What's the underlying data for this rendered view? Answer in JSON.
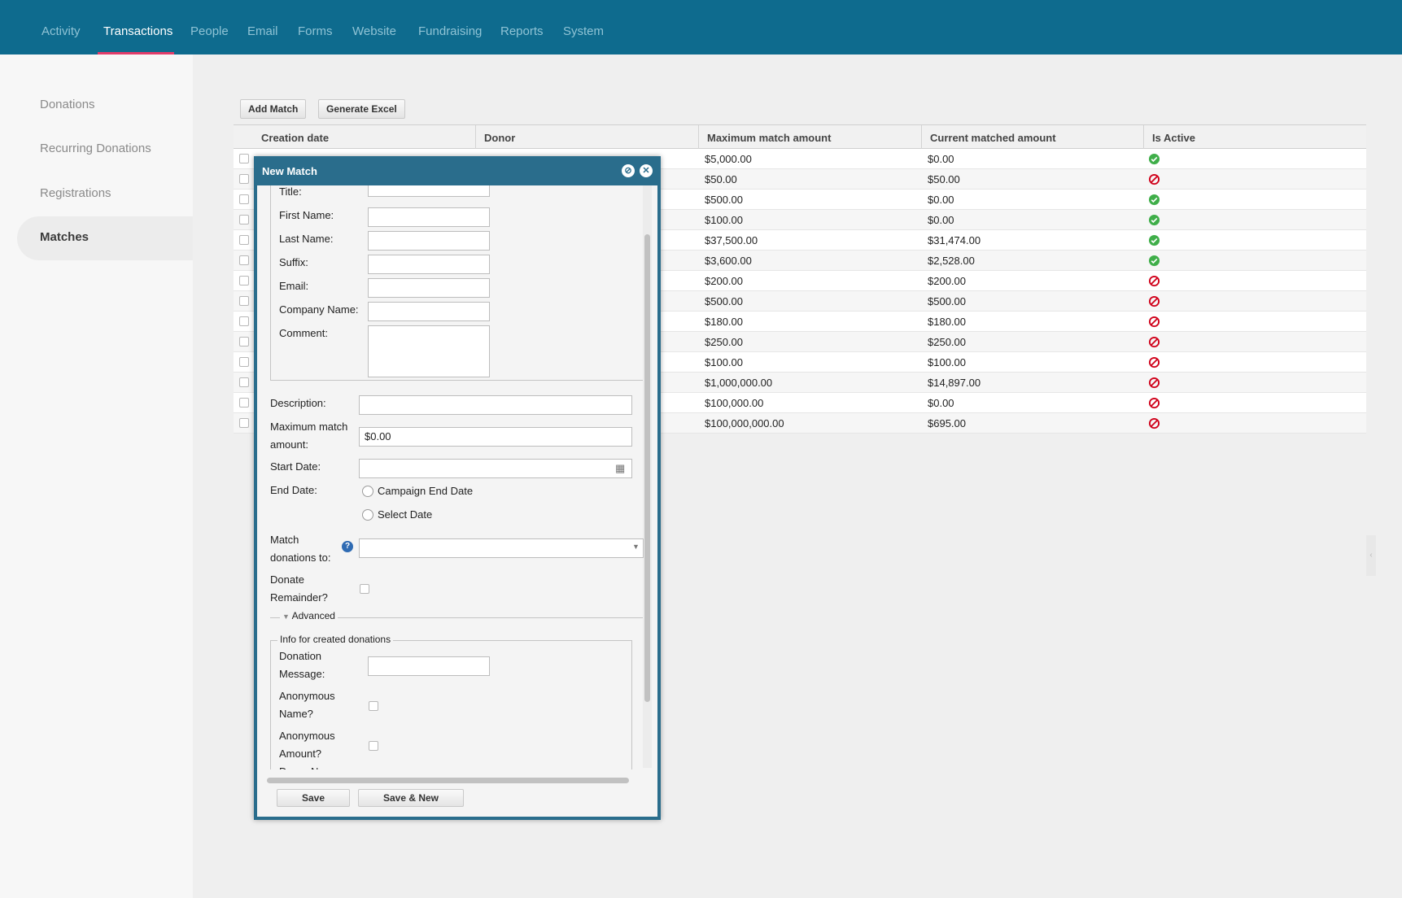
{
  "nav": {
    "tabs": [
      "Activity",
      "Transactions",
      "People",
      "Email",
      "Forms",
      "Website",
      "Fundraising",
      "Reports",
      "System"
    ],
    "active_tab": "Transactions"
  },
  "sidebar": {
    "items": [
      "Donations",
      "Recurring Donations",
      "Registrations",
      "Matches"
    ],
    "active": "Matches"
  },
  "toolbar": {
    "add_label": "Add Match",
    "excel_label": "Generate Excel"
  },
  "grid": {
    "columns": [
      "Creation date",
      "Donor",
      "Maximum match amount",
      "Current matched amount",
      "Is Active"
    ],
    "rows": [
      {
        "max": "$5,000.00",
        "current": "$0.00",
        "active": true
      },
      {
        "max": "$50.00",
        "current": "$50.00",
        "active": false
      },
      {
        "max": "$500.00",
        "current": "$0.00",
        "active": true
      },
      {
        "max": "$100.00",
        "current": "$0.00",
        "active": true
      },
      {
        "max": "$37,500.00",
        "current": "$31,474.00",
        "active": true
      },
      {
        "max": "$3,600.00",
        "current": "$2,528.00",
        "active": true
      },
      {
        "max": "$200.00",
        "current": "$200.00",
        "active": false
      },
      {
        "max": "$500.00",
        "current": "$500.00",
        "active": false
      },
      {
        "max": "$180.00",
        "current": "$180.00",
        "active": false
      },
      {
        "max": "$250.00",
        "current": "$250.00",
        "active": false
      },
      {
        "max": "$100.00",
        "current": "$100.00",
        "active": false
      },
      {
        "max": "$1,000,000.00",
        "current": "$14,897.00",
        "active": false
      },
      {
        "max": "$100,000.00",
        "current": "$0.00",
        "active": false
      },
      {
        "max": "$100,000,000.00",
        "current": "$695.00",
        "active": false
      }
    ],
    "active_color": "#3fae49",
    "inactive_color": "#d0021b"
  },
  "modal": {
    "title": "New Match",
    "fields": {
      "title": "Title:",
      "first_name": "First Name:",
      "last_name": "Last Name:",
      "suffix": "Suffix:",
      "email": "Email:",
      "company": "Company Name:",
      "comment": "Comment:",
      "description": "Description:",
      "max_match_1": "Maximum match",
      "max_match_2": "amount:",
      "max_match_value": "$0.00",
      "start_date": "Start Date:",
      "end_date": "End Date:",
      "end_opt1": "Campaign End Date",
      "end_opt2": "Select Date",
      "match_to_1": "Match",
      "match_to_2": "donations to:",
      "donate_rem_1": "Donate",
      "donate_rem_2": "Remainder?",
      "advanced": "Advanced",
      "info_legend": "Info for created donations",
      "don_msg_1": "Donation",
      "don_msg_2": "Message:",
      "anon_name_1": "Anonymous",
      "anon_name_2": "Name?",
      "anon_amt_1": "Anonymous",
      "anon_amt_2": "Amount?",
      "donor_name": "Donor Name"
    },
    "save_label": "Save",
    "save_new_label": "Save & New"
  }
}
